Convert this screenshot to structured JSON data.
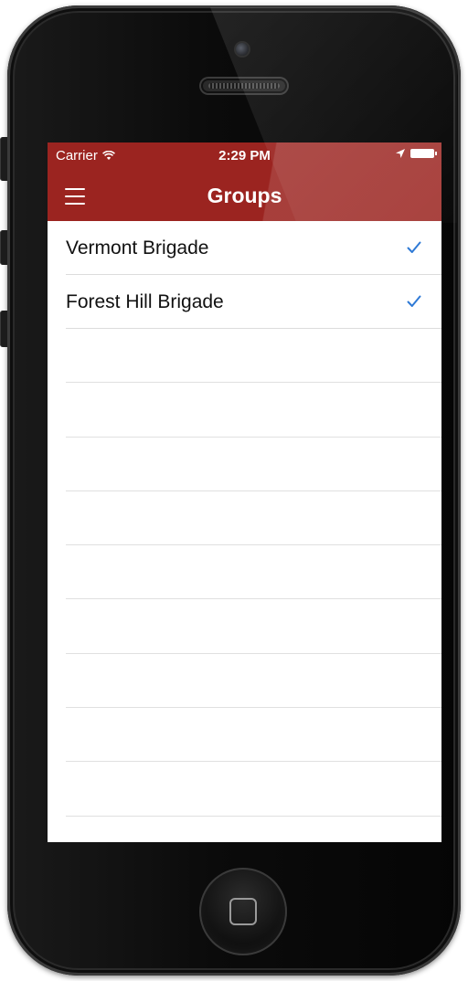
{
  "status_bar": {
    "carrier": "Carrier",
    "time": "2:29 PM"
  },
  "nav": {
    "title": "Groups",
    "menu_icon": "hamburger-menu-icon"
  },
  "groups": [
    {
      "label": "Vermont Brigade",
      "checked": true
    },
    {
      "label": "Forest Hill Brigade",
      "checked": true
    }
  ],
  "colors": {
    "nav_background": "#9b2420",
    "checkmark": "#2f7ad6",
    "text": "#111111"
  },
  "icons": {
    "wifi": "wifi-icon",
    "location": "location-arrow-icon",
    "battery": "battery-icon",
    "check": "checkmark-icon",
    "home": "home-button-icon"
  }
}
